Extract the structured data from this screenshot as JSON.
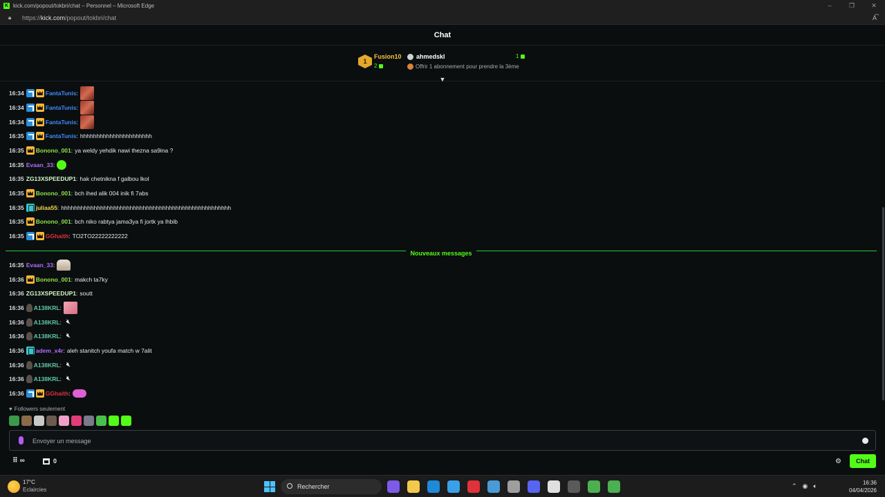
{
  "browser": {
    "title": "kick.com/popout/tokbri/chat – Personnel – Microsoft Edge",
    "url_prefix": "https://",
    "url_host": "kick.com",
    "url_path": "/popout/tokbri/chat"
  },
  "header": {
    "title": "Chat"
  },
  "leaderboard": {
    "first": {
      "rank": "1",
      "name": "Fusion10",
      "count": "2"
    },
    "second": {
      "name": "ahmedskl",
      "count": "1"
    },
    "offer": "Offrir 1 abonnement pour prendre la 3ème"
  },
  "colors": {
    "accent": "#53fc18",
    "vip_badge": "#2b8ed8",
    "sub_badge": "#f6b83b",
    "gift_badge": "#3cc3c9",
    "divider": "#2cc93b"
  },
  "messages": [
    {
      "time": "16:34",
      "badges": [
        "vip",
        "crown"
      ],
      "user": "FantaTunis",
      "color": "#3d8bff",
      "text": "",
      "emote": "face"
    },
    {
      "time": "16:34",
      "badges": [
        "vip",
        "crown"
      ],
      "user": "FantaTunis",
      "color": "#3d8bff",
      "text": "",
      "emote": "face"
    },
    {
      "time": "16:34",
      "badges": [
        "vip",
        "crown"
      ],
      "user": "FantaTunis",
      "color": "#3d8bff",
      "text": "",
      "emote": "face"
    },
    {
      "time": "16:35",
      "badges": [
        "vip",
        "crown"
      ],
      "user": "FantaTunis",
      "color": "#3d8bff",
      "text": "hhhhhhhhhhhhhhhhhhhhhh",
      "emote": ""
    },
    {
      "time": "16:35",
      "badges": [
        "crown"
      ],
      "user": "Bonono_001",
      "color": "#8fe34c",
      "text": "ya weldy yehdik nawi thezna sa9ina ?",
      "emote": ""
    },
    {
      "time": "16:35",
      "badges": [],
      "user": "Evaan_33",
      "color": "#b46cff",
      "text": "",
      "emote": "green"
    },
    {
      "time": "16:35",
      "badges": [],
      "user": "ZG13XSPEEDUP1",
      "color": "#d6f8c8",
      "text": "hak chetnikna f galbou lkol",
      "emote": ""
    },
    {
      "time": "16:35",
      "badges": [
        "crown"
      ],
      "user": "Bonono_001",
      "color": "#8fe34c",
      "text": "bch ihed alik 004 inik fi 7abs",
      "emote": ""
    },
    {
      "time": "16:35",
      "badges": [
        "gift"
      ],
      "user": "juliaa55",
      "color": "#f7d94c",
      "text": "hhhhhhhhhhhhhhhhhhhhhhhhhhhhhhhhhhhhhhhhhhhhhhhhhhhh",
      "emote": ""
    },
    {
      "time": "16:35",
      "badges": [
        "crown"
      ],
      "user": "Bonono_001",
      "color": "#8fe34c",
      "text": "bch niko rabtya jama3ya fi jortk ya lhbib",
      "emote": ""
    },
    {
      "time": "16:35",
      "badges": [
        "vip",
        "crown"
      ],
      "user": "GGhaith",
      "color": "#e0323b",
      "text": "TO2TO22222222222",
      "emote": ""
    },
    {
      "time": "16:35",
      "badges": [],
      "user": "Evaan_33",
      "color": "#b46cff",
      "text": "",
      "emote": "guy"
    },
    {
      "time": "16:36",
      "badges": [
        "crown"
      ],
      "user": "Bonono_001",
      "color": "#8fe34c",
      "text": "makch ta7ky",
      "emote": ""
    },
    {
      "time": "16:36",
      "badges": [],
      "user": "ZG13XSPEEDUP1",
      "color": "#d6f8c8",
      "text": "soutt",
      "emote": ""
    },
    {
      "time": "16:36",
      "badges": [
        "avatar"
      ],
      "user": "A138KRL",
      "color": "#5ec9a7",
      "text": "",
      "emote": "pink"
    },
    {
      "time": "16:36",
      "badges": [
        "avatar"
      ],
      "user": "A138KRL",
      "color": "#5ec9a7",
      "text": "",
      "emote": "mute"
    },
    {
      "time": "16:36",
      "badges": [
        "avatar"
      ],
      "user": "A138KRL",
      "color": "#5ec9a7",
      "text": "",
      "emote": "mute"
    },
    {
      "time": "16:36",
      "badges": [
        "gift"
      ],
      "user": "adem_x4r",
      "color": "#b46cff",
      "text": "aleh stanitch youfa match w 7alit",
      "emote": ""
    },
    {
      "time": "16:36",
      "badges": [
        "avatar"
      ],
      "user": "A138KRL",
      "color": "#5ec9a7",
      "text": "",
      "emote": "mute"
    },
    {
      "time": "16:36",
      "badges": [
        "avatar"
      ],
      "user": "A138KRL",
      "color": "#5ec9a7",
      "text": "",
      "emote": "mute"
    },
    {
      "time": "16:36",
      "badges": [
        "vip",
        "crown"
      ],
      "user": "GGhaith",
      "color": "#e0323b",
      "text": "",
      "emote": "pac"
    }
  ],
  "new_messages_label": "Nouveaux messages",
  "followers_only": "Followers seulement",
  "emote_bar": [
    "#3a9a4a",
    "#8a6a4a",
    "#c8c8c8",
    "#6a5a50",
    "#f0a0c8",
    "#e23d7a",
    "#7a7a8a",
    "#4ac04a",
    "#53fc18",
    "#53fc18"
  ],
  "input": {
    "placeholder": "Envoyer un message"
  },
  "footer": {
    "points": "∞",
    "store_count": "0",
    "chat_button": "Chat"
  },
  "taskbar": {
    "temperature": "17°C",
    "weather": "Eclaircies",
    "search": "Rechercher",
    "time": "16:36",
    "date": "04/04/2026",
    "apps": [
      "#7e5ae8",
      "#f2c94c",
      "#1f8ad8",
      "#3aa0e8",
      "#e0323b",
      "#4a9ad8",
      "#9e9e9e",
      "#5865f2",
      "#e0e0e0",
      "#5a5a5a",
      "#4caf50",
      "#4caf50"
    ]
  }
}
